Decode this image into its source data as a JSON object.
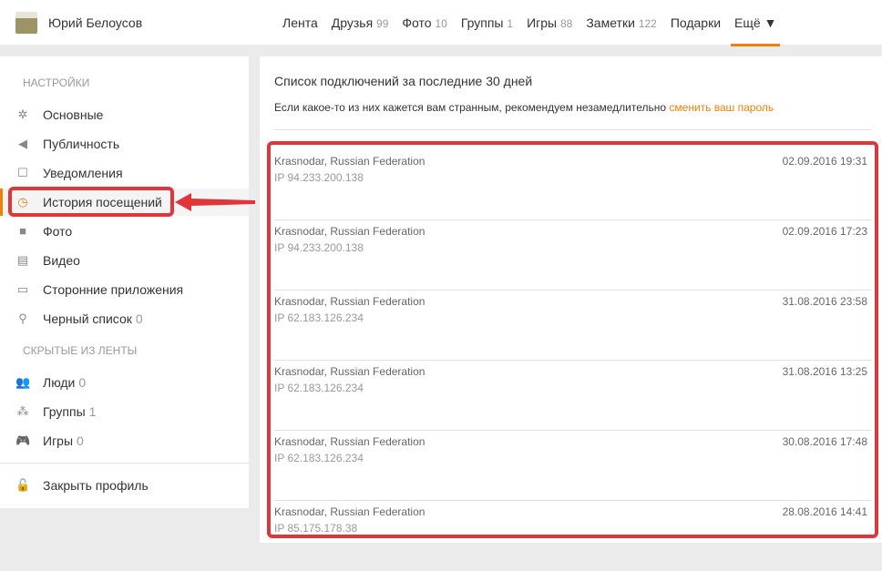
{
  "header": {
    "user_name": "Юрий Белоусов",
    "nav": [
      {
        "label": "Лента",
        "count": ""
      },
      {
        "label": "Друзья",
        "count": "99"
      },
      {
        "label": "Фото",
        "count": "10"
      },
      {
        "label": "Группы",
        "count": "1"
      },
      {
        "label": "Игры",
        "count": "88"
      },
      {
        "label": "Заметки",
        "count": "122"
      },
      {
        "label": "Подарки",
        "count": ""
      },
      {
        "label": "Ещё ▼",
        "count": ""
      }
    ]
  },
  "sidebar": {
    "settings_heading": "НАСТРОЙКИ",
    "items": [
      {
        "label": "Основные",
        "icon": "gear-icon"
      },
      {
        "label": "Публичность",
        "icon": "megaphone-icon"
      },
      {
        "label": "Уведомления",
        "icon": "notification-icon"
      },
      {
        "label": "История посещений",
        "icon": "history-icon"
      },
      {
        "label": "Фото",
        "icon": "camera-icon"
      },
      {
        "label": "Видео",
        "icon": "film-icon"
      },
      {
        "label": "Сторонние приложения",
        "icon": "window-icon"
      },
      {
        "label": "Черный список",
        "count": "0",
        "icon": "blocked-user-icon"
      }
    ],
    "hidden_heading": "СКРЫТЫЕ ИЗ ЛЕНТЫ",
    "hidden_items": [
      {
        "label": "Люди",
        "count": "0"
      },
      {
        "label": "Группы",
        "count": "1"
      },
      {
        "label": "Игры",
        "count": "0"
      }
    ],
    "close_profile": "Закрыть профиль"
  },
  "main": {
    "title": "Список подключений за последние 30 дней",
    "subtitle": "Если какое-то из них кажется вам странным, рекомендуем незамедлительно",
    "change_password_link": "сменить ваш пароль",
    "sessions": [
      {
        "location": "Krasnodar, Russian Federation",
        "ip": "IP 94.233.200.138",
        "datetime": "02.09.2016 19:31"
      },
      {
        "location": "Krasnodar, Russian Federation",
        "ip": "IP 94.233.200.138",
        "datetime": "02.09.2016 17:23"
      },
      {
        "location": "Krasnodar, Russian Federation",
        "ip": "IP 62.183.126.234",
        "datetime": "31.08.2016 23:58"
      },
      {
        "location": "Krasnodar, Russian Federation",
        "ip": "IP 62.183.126.234",
        "datetime": "31.08.2016 13:25"
      },
      {
        "location": "Krasnodar, Russian Federation",
        "ip": "IP 62.183.126.234",
        "datetime": "30.08.2016 17:48"
      },
      {
        "location": "Krasnodar, Russian Federation",
        "ip": "IP 85.175.178.38",
        "datetime": "28.08.2016 14:41"
      }
    ]
  },
  "colors": {
    "accent": "#ee8208",
    "annotation": "#e0363a"
  }
}
